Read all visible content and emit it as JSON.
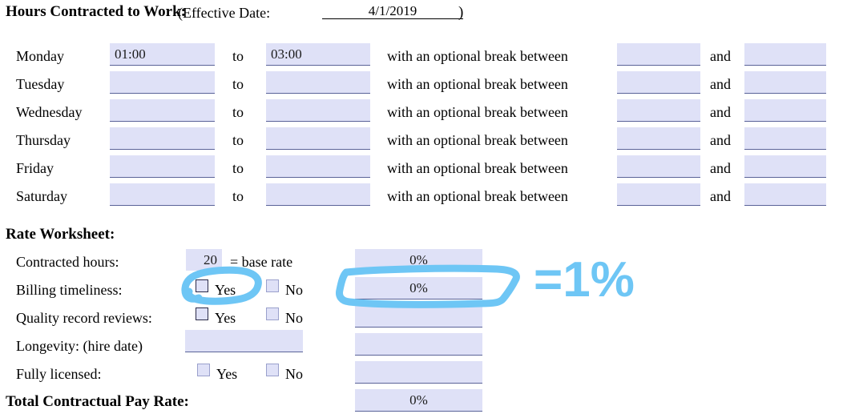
{
  "header": {
    "title": "Hours Contracted to Work:",
    "effective_label": "(Effective Date:",
    "effective_date": "4/1/2019",
    "paren_close": ")"
  },
  "schedule": {
    "to_label": "to",
    "break_label": "with an optional break between",
    "and_label": "and",
    "rows": [
      {
        "day": "Monday",
        "start": "01:00",
        "end": "03:00",
        "break_start": "",
        "break_end": ""
      },
      {
        "day": "Tuesday",
        "start": "",
        "end": "",
        "break_start": "",
        "break_end": ""
      },
      {
        "day": "Wednesday",
        "start": "",
        "end": "",
        "break_start": "",
        "break_end": ""
      },
      {
        "day": "Thursday",
        "start": "",
        "end": "",
        "break_start": "",
        "break_end": ""
      },
      {
        "day": "Friday",
        "start": "",
        "end": "",
        "break_start": "",
        "break_end": ""
      },
      {
        "day": "Saturday",
        "start": "",
        "end": "",
        "break_start": "",
        "break_end": ""
      }
    ]
  },
  "rate_worksheet": {
    "section_title": "Rate Worksheet:",
    "yes_label": "Yes",
    "no_label": "No",
    "contracted_hours": {
      "label": "Contracted hours:",
      "value": "20",
      "suffix": "= base rate",
      "percent": "0%"
    },
    "billing_timeliness": {
      "label": "Billing timeliness:",
      "percent": "0%"
    },
    "quality_record_reviews": {
      "label": "Quality record reviews:",
      "percent": ""
    },
    "longevity": {
      "label": "Longevity: (hire date)",
      "value": "",
      "percent": ""
    },
    "fully_licensed": {
      "label": "Fully licensed:",
      "percent": ""
    },
    "total": {
      "label": "Total Contractual Pay Rate:",
      "percent": "0%"
    }
  },
  "annotation": {
    "equals_one_percent": "=1%",
    "color": "#6ec6f5"
  }
}
